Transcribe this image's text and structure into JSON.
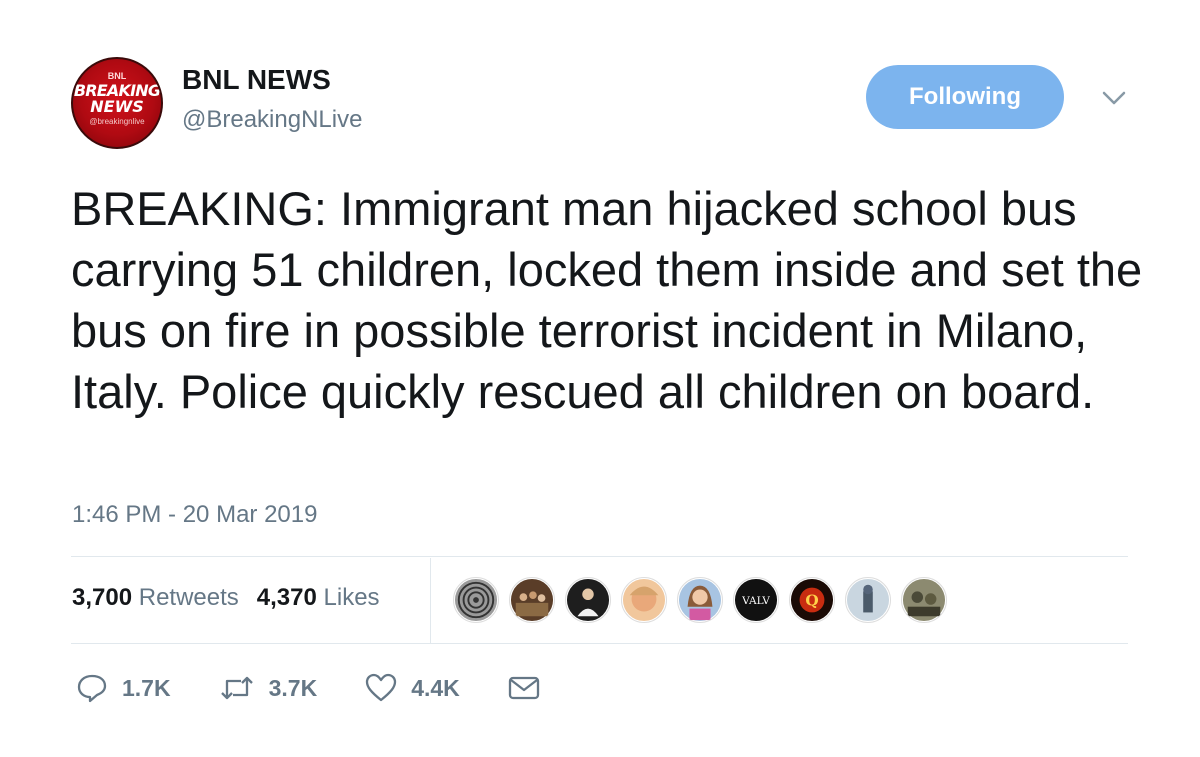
{
  "author": {
    "name": "BNL NEWS",
    "handle": "@BreakingNLive",
    "avatar_lines": [
      "BNL",
      "BREAKING",
      "NEWS",
      "@breakingnlive"
    ]
  },
  "follow_button": {
    "label": "Following",
    "color": "#7cb4ee"
  },
  "tweet": {
    "text": "BREAKING: Immigrant man hijacked school bus carrying 51 children, locked them inside and set the bus on fire in possible terrorist incident in Milano, Italy. Police quickly rescued all children on board.",
    "timestamp": "1:46 PM - 20 Mar 2019"
  },
  "stats": {
    "retweets_count": "3,700",
    "retweets_label": "Retweets",
    "likes_count": "4,370",
    "likes_label": "Likes"
  },
  "liker_avatars": [
    {
      "icon": "spiral-avatar-icon",
      "color": "#8a8a8a"
    },
    {
      "icon": "crowd-avatar-icon",
      "color": "#6b4a2f"
    },
    {
      "icon": "person-dark-avatar-icon",
      "color": "#222222"
    },
    {
      "icon": "face-avatar-icon",
      "color": "#e9b58c"
    },
    {
      "icon": "woman-avatar-icon",
      "color": "#c9a0c8"
    },
    {
      "icon": "valv-avatar-icon",
      "color": "#111111",
      "text": "VALV"
    },
    {
      "icon": "q-avatar-icon",
      "color": "#1a0a05",
      "text": "Q"
    },
    {
      "icon": "statue-avatar-icon",
      "color": "#7b8c99"
    },
    {
      "icon": "army-avatar-icon",
      "color": "#6e6a55"
    }
  ],
  "actions": {
    "reply_count": "1.7K",
    "retweet_count": "3.7K",
    "like_count": "4.4K"
  }
}
